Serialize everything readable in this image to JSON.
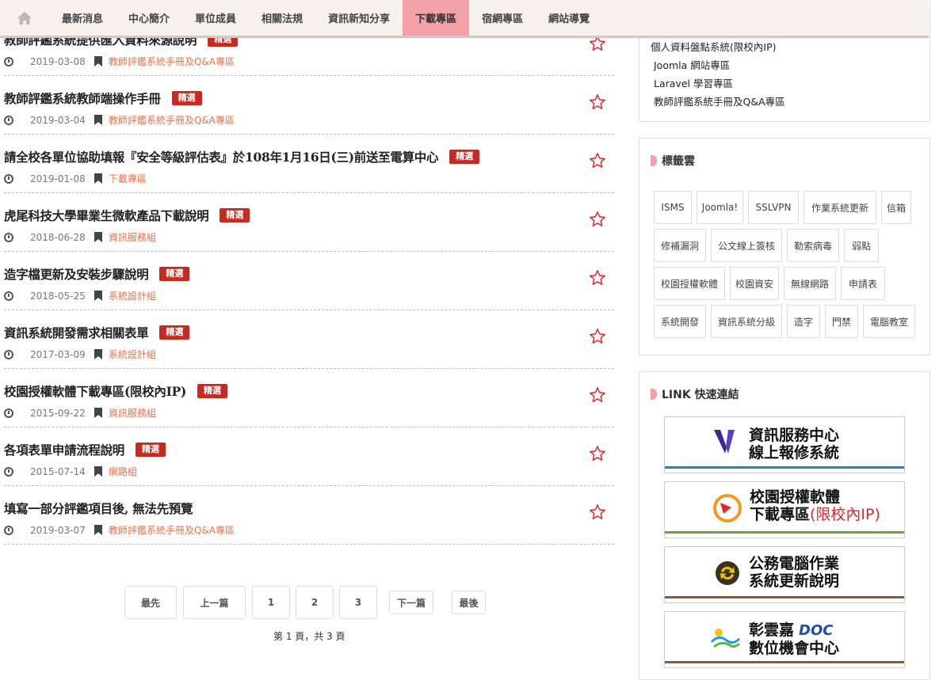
{
  "nav": {
    "home_icon": "home-icon",
    "items": [
      "最新消息",
      "中心簡介",
      "單位成員",
      "相關法規",
      "資訊新知分享",
      "下載專區",
      "宿網專區",
      "網站導覽"
    ],
    "active_index": 5
  },
  "posts": [
    {
      "title": "教師評鑑系統提供匯入資料來源說明",
      "badge": "精選",
      "date": "2019-03-08",
      "category": "教師評鑑系統手冊及Q&A專區"
    },
    {
      "title": "教師評鑑系統教師端操作手冊",
      "badge": "精選",
      "date": "2019-03-04",
      "category": "教師評鑑系統手冊及Q&A專區"
    },
    {
      "title": "請全校各單位協助填報『安全等級評估表』於108年1月16日(三)前送至電算中心",
      "badge": "精選",
      "date": "2019-01-08",
      "category": "下載專區"
    },
    {
      "title": "虎尾科技大學畢業生微軟產品下載說明",
      "badge": "精選",
      "date": "2018-06-28",
      "category": "資訊服務組"
    },
    {
      "title": "造字檔更新及安裝步驟說明",
      "badge": "精選",
      "date": "2018-05-25",
      "category": "系統設計組"
    },
    {
      "title": "資訊系統開發需求相關表單",
      "badge": "精選",
      "date": "2017-03-09",
      "category": "系統設計組"
    },
    {
      "title": "校園授權軟體下載專區(限校內IP)",
      "badge": "精選",
      "date": "2015-09-22",
      "category": "資訊服務組"
    },
    {
      "title": "各項表單申請流程說明",
      "badge": "精選",
      "date": "2015-07-14",
      "category": "網路組"
    },
    {
      "title": "填寫一部分評鑑項目後, 無法先預覽",
      "badge": "",
      "date": "2019-03-07",
      "category": "教師評鑑系統手冊及Q&A專區"
    }
  ],
  "pagination": {
    "first": "最先",
    "prev": "上一篇",
    "pages": [
      "1",
      "2",
      "3"
    ],
    "next": "下一篇",
    "last": "最後",
    "info": "第 1 頁，共 3 頁"
  },
  "sidebar": {
    "categories": [
      "個人資料盤點系統(限校內IP)",
      "Joomla 網站專區",
      "Laravel 學習專區",
      "教師評鑑系統手冊及Q&A專區"
    ],
    "tags_title": "標籤雲",
    "tags": [
      "ISMS",
      "Joomla!",
      "SSLVPN",
      "作業系統更新",
      "信箱",
      "修補漏洞",
      "公文線上簽核",
      "勒索病毒",
      "弱點",
      "校園授權軟體",
      "校園資安",
      "無線網路",
      "申請表",
      "系統開發",
      "資訊系統分級",
      "造字",
      "門禁",
      "電腦教室"
    ],
    "links_title": "LINK 快速連結",
    "links": [
      {
        "line1": "資訊服務中心",
        "line2": "線上報修系統",
        "extra": "",
        "accent": "#2b7fc0"
      },
      {
        "line1": "校園授權軟體",
        "line2": "下載專區",
        "extra": "(限校內IP)",
        "accent": "#6aa43a"
      },
      {
        "line1": "公務電腦作業",
        "line2": "系統更新說明",
        "extra": "",
        "accent": "#8a5a2b"
      },
      {
        "line1": "彰雲嘉",
        "line2": "數位機會中心",
        "extra": "DOC",
        "accent": "#8a5a2b"
      }
    ]
  },
  "colors": {
    "accent_pink": "#f3a0a6",
    "badge_red": "#c82a1f",
    "category_orange": "#e7734f"
  }
}
